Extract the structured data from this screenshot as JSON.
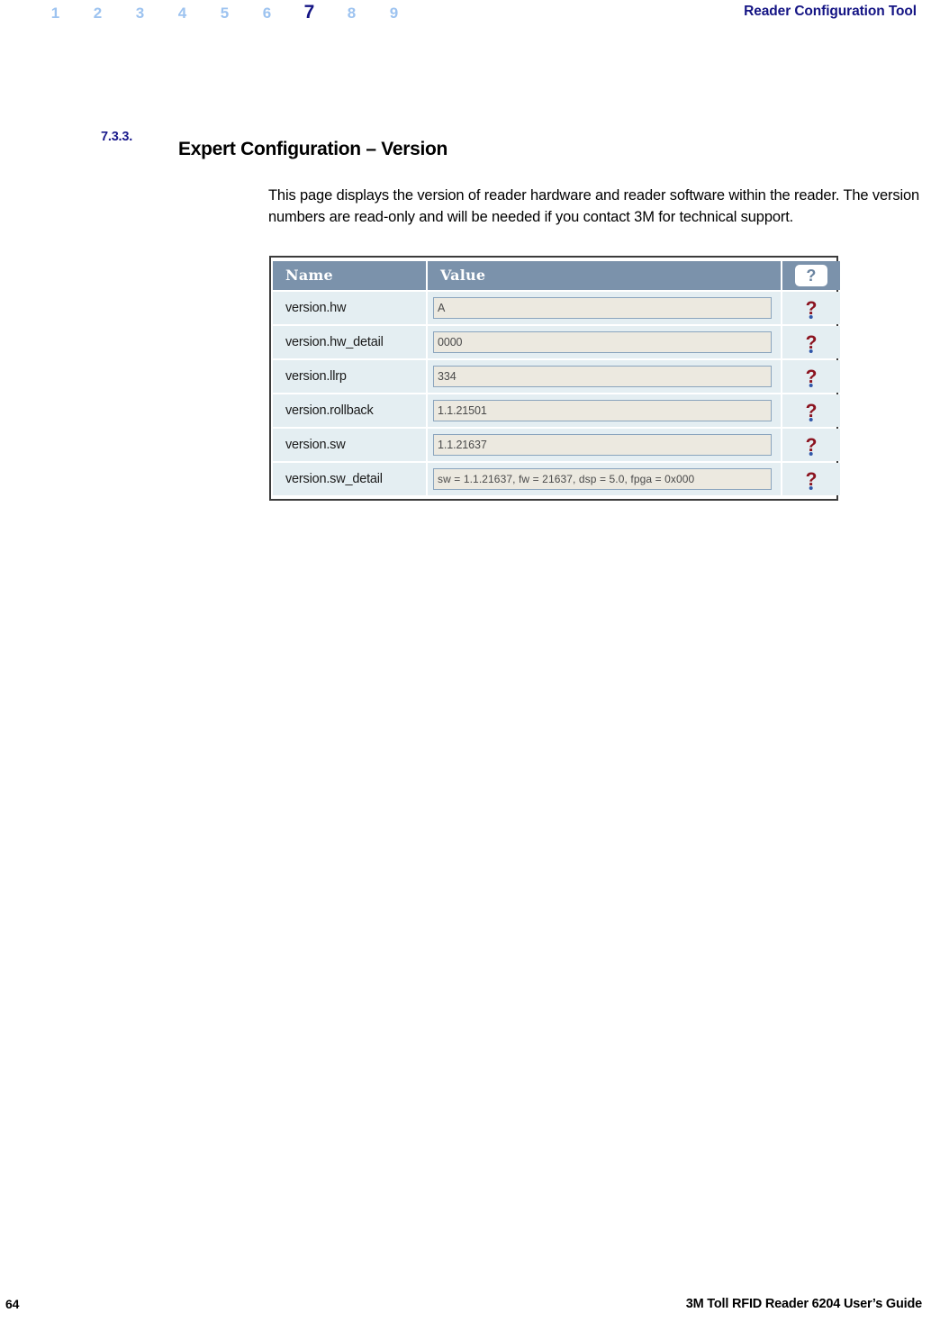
{
  "header": {
    "tabs": [
      {
        "label": "1",
        "active": false
      },
      {
        "label": "2",
        "active": false
      },
      {
        "label": "3",
        "active": false
      },
      {
        "label": "4",
        "active": false
      },
      {
        "label": "5",
        "active": false
      },
      {
        "label": "6",
        "active": false
      },
      {
        "label": "7",
        "active": true
      },
      {
        "label": "8",
        "active": false
      },
      {
        "label": "9",
        "active": false
      }
    ],
    "title": "Reader Configuration Tool",
    "active_tab_color": "#141484",
    "inactive_tab_color": "#9dc3f0"
  },
  "section": {
    "number": "7.3.3.",
    "title": "Expert Configuration – Version",
    "number_color": "#1a1a8c",
    "paragraph": "This page displays the version of reader hardware and reader software within the reader. The version numbers are read-only and will be needed if you contact 3M for technical support."
  },
  "screenshot": {
    "header_bg": "#7b92ab",
    "row_bg": "#e4eef2",
    "input_bg": "#ece9e0",
    "columns": {
      "name": "Name",
      "value": "Value",
      "help_icon": "question-mark-icon",
      "help_glyph": "?"
    },
    "rows": [
      {
        "name": "version.hw",
        "value": "A",
        "help": "?"
      },
      {
        "name": "version.hw_detail",
        "value": "0000",
        "help": "?"
      },
      {
        "name": "version.llrp",
        "value": "334",
        "help": "?"
      },
      {
        "name": "version.rollback",
        "value": "1.1.21501",
        "help": "?"
      },
      {
        "name": "version.sw",
        "value": "1.1.21637",
        "help": "?"
      },
      {
        "name": "version.sw_detail",
        "value": "sw = 1.1.21637, fw = 21637, dsp = 5.0, fpga = 0x000",
        "help": "?"
      }
    ]
  },
  "footer": {
    "page_number": "64",
    "guide_title": "3M Toll RFID Reader 6204 User’s Guide"
  }
}
